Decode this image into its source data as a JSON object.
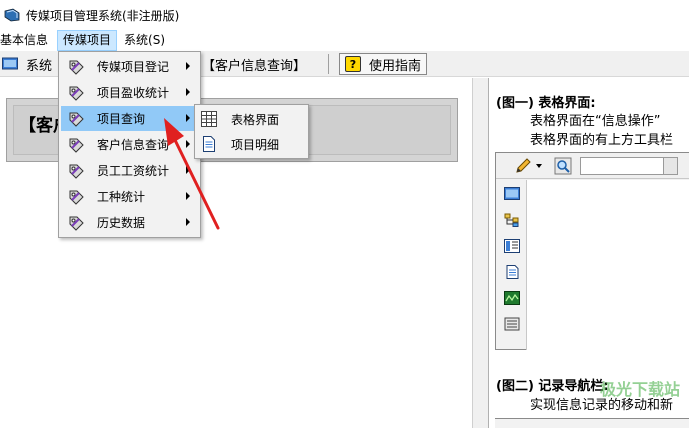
{
  "window": {
    "title": "传媒项目管理系统(非注册版)"
  },
  "menubar": {
    "items": [
      {
        "label": "基本信息"
      },
      {
        "label": "传媒项目"
      },
      {
        "label": "系统(S)"
      }
    ]
  },
  "toolbar": {
    "partial_label": "系统",
    "query_label": "【客户信息查询】",
    "guide_label": "使用指南",
    "guide_icon_glyph": "?"
  },
  "main": {
    "title_partial": "【客户"
  },
  "dropdown": {
    "items": [
      {
        "label": "传媒项目登记"
      },
      {
        "label": "项目盈收统计"
      },
      {
        "label": "项目查询"
      },
      {
        "label": "客户信息查询"
      },
      {
        "label": "员工工资统计"
      },
      {
        "label": "工种统计"
      },
      {
        "label": "历史数据"
      }
    ],
    "highlighted_index": 2
  },
  "submenu": {
    "items": [
      {
        "label": "表格界面"
      },
      {
        "label": "项目明细"
      }
    ]
  },
  "help": {
    "section1_heading": "(图一) 表格界面:",
    "section1_line1": "表格界面在“信息操作”",
    "section1_line2": "表格界面的有上方工具栏",
    "section2_heading": "(图二) 记录导航栏:",
    "section2_line1": "实现信息记录的移动和新"
  },
  "watermark": {
    "text": "极光下载站"
  },
  "colors": {
    "menu_active_bg": "#cce8ff",
    "dropdown_highlight": "#91c9f7",
    "annotation_arrow": "#e02020"
  }
}
